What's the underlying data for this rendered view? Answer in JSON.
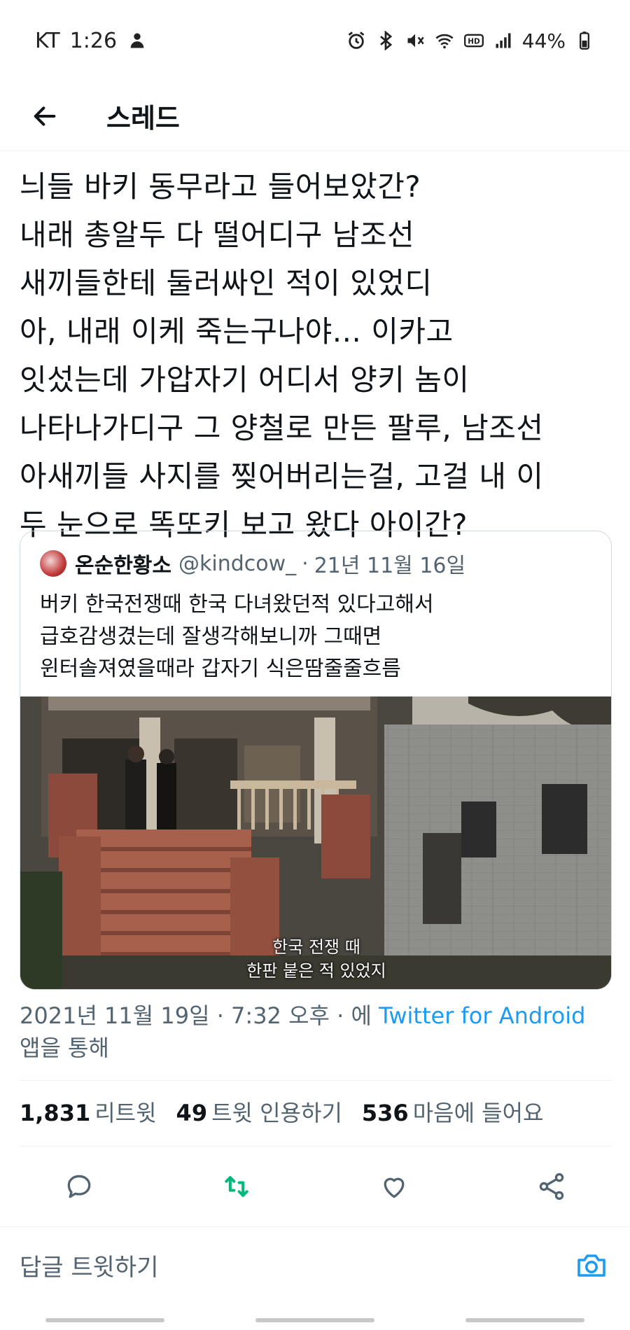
{
  "status_bar": {
    "carrier": "KT",
    "time": "1:26",
    "battery": "44%",
    "icons": [
      "alarm-icon",
      "bluetooth-icon",
      "mute-icon",
      "wifi-icon",
      "hd-icon",
      "signal-icon",
      "battery-icon"
    ]
  },
  "header": {
    "title": "스레드"
  },
  "tweet": {
    "text": "늬들 바키 동무라고 들어보았간?\n내래 총알두 다 떨어디구 남조선\n새끼들한테 둘러싸인 적이 있었디\n아, 내래 이케 죽는구나야... 이카고\n잇섰는데 가압자기 어디서 양키 놈이\n나타나가디구 그 양철로 만든 팔루, 남조선\n아새끼들 사지를 찢어버리는걸, 고걸 내 이\n두 눈으로 똑또키 보고 왔다 아이간?"
  },
  "quote": {
    "name": "온순한황소",
    "handle": "@kindcow_",
    "separator": "·",
    "date": "21년 11월 16일",
    "text": "버키 한국전쟁때 한국 다녀왔던적 있다고해서\n급호감생겼는데 잘생각해보니까 그때면\n윈터솔져였을때라 갑자기 식은땀줄줄흐름",
    "subtitle_line1": "한국 전쟁 때",
    "subtitle_line2": "한판 붙은 적 있었지"
  },
  "meta": {
    "timestamp": "2021년 11월 19일 · 7:32 오후 · 에",
    "source": "Twitter for Android",
    "suffix": "앱을 통해"
  },
  "stats": [
    {
      "count": "1,831",
      "label": "리트윗"
    },
    {
      "count": "49",
      "label": "트윗 인용하기"
    },
    {
      "count": "536",
      "label": "마음에 들어요"
    }
  ],
  "reply": {
    "placeholder": "답글 트윗하기"
  },
  "colors": {
    "accent": "#1d9bf0",
    "retweet_green": "#00ba7c",
    "secondary_text": "#536471",
    "border": "#cfd9de"
  }
}
